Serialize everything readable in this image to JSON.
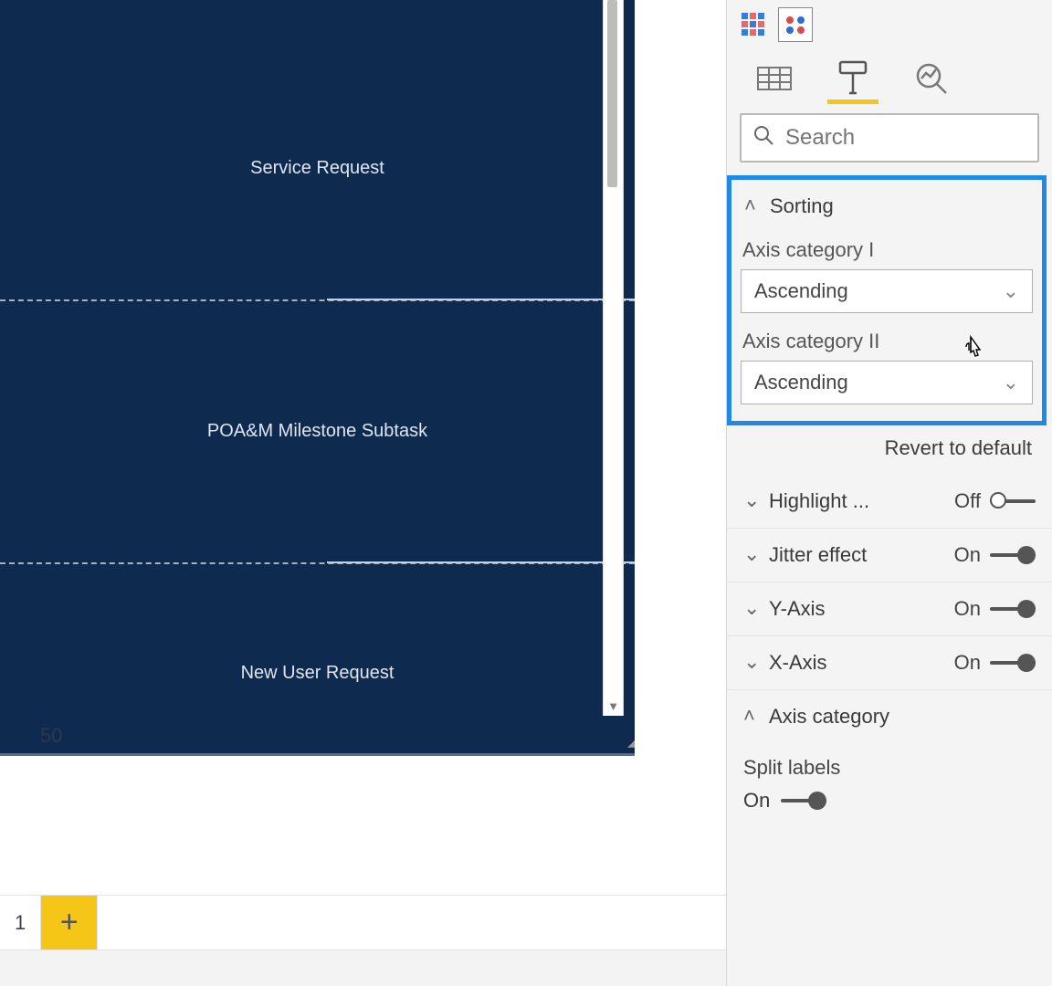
{
  "canvas": {
    "rows": [
      {
        "label": "Service Request"
      },
      {
        "label": "POA&M Milestone Subtask"
      },
      {
        "label": "New User Request"
      }
    ],
    "xaxis_tick": "50"
  },
  "tabs": {
    "page_label": "1",
    "add_label": "+"
  },
  "vis_palette": {
    "icons": [
      "matrix-icon",
      "key-influencers-icon"
    ]
  },
  "pane_tabs": {
    "fields": "fields-icon",
    "format": "format-icon",
    "analytics": "analytics-icon"
  },
  "search": {
    "placeholder": "Search",
    "value": ""
  },
  "sorting": {
    "title": "Sorting",
    "axis1_label": "Axis category I",
    "axis1_value": "Ascending",
    "axis2_label": "Axis category II",
    "axis2_value": "Ascending",
    "revert": "Revert to default"
  },
  "rows": {
    "highlight": {
      "label": "Highlight ...",
      "state": "Off"
    },
    "jitter": {
      "label": "Jitter effect",
      "state": "On"
    },
    "yaxis": {
      "label": "Y-Axis",
      "state": "On"
    },
    "xaxis": {
      "label": "X-Axis",
      "state": "On"
    }
  },
  "axis_category": {
    "title": "Axis category",
    "split_labels_title": "Split labels",
    "split_labels_state": "On"
  }
}
